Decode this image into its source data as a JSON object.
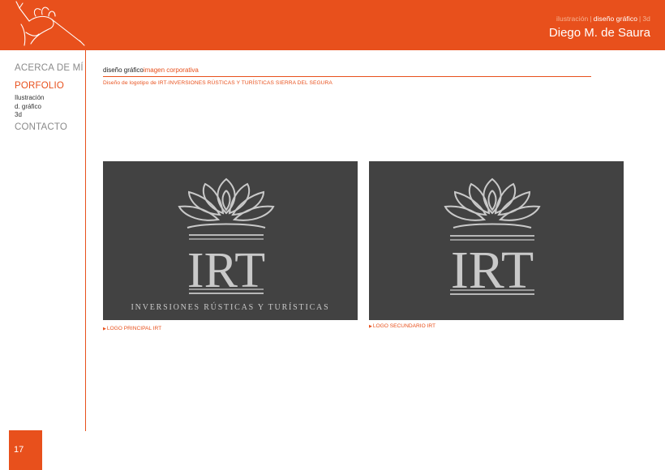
{
  "header": {
    "nav": {
      "illustration": "ilustración",
      "sep": "|",
      "graphic_design": "diseño gráfico",
      "three_d": "3d"
    },
    "name": "Diego M. de Saura"
  },
  "sidebar": {
    "about": "ACERCA DE MÍ",
    "portfolio": "PORFOLIO",
    "sub": [
      "Ilustración",
      "d. gráfico",
      "3d"
    ],
    "contact": "CONTACTO"
  },
  "content": {
    "breadcrumb_section": "diseño gráfico",
    "breadcrumb_sub": "imagen corporativa",
    "description": "Diseño de logotipo de IRT-INVERSIONES RÚSTICAS Y TURÍSTICAS SIERRA DEL SEGURA",
    "logos": [
      {
        "text": "IRT",
        "tagline": "INVERSIONES RÚSTICAS Y TURÍSTICAS",
        "caption": "LOGO PRINCIPAL IRT"
      },
      {
        "text": "IRT",
        "caption": "LOGO SECUNDARIO IRT"
      }
    ]
  },
  "page_number": "17",
  "colors": {
    "accent": "#e8501c",
    "card": "#424242",
    "logo": "#c9c9c9"
  },
  "icons": {
    "header_art": "hand-with-brush-icon",
    "caption_marker": "triangle-right-icon",
    "logo_mark": "lotus-icon"
  }
}
